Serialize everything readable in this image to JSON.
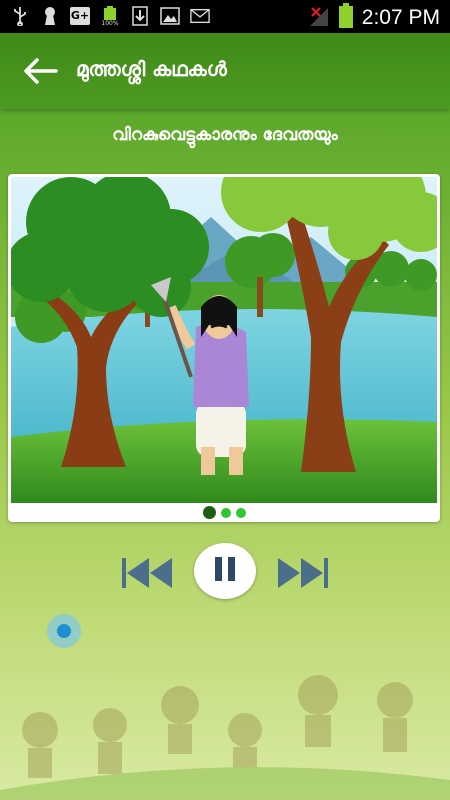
{
  "status_bar": {
    "time": "2:07 PM",
    "battery_label": "100%",
    "icons": [
      "usb-icon",
      "keyhole-icon",
      "google-plus-icon",
      "battery-full-icon",
      "download-icon",
      "image-icon",
      "email-icon",
      "no-signal-icon",
      "battery-icon"
    ],
    "gplus_text": "G+"
  },
  "app_bar": {
    "title": "മുത്തശ്ശി കഥകൾ"
  },
  "story": {
    "title": "വിറകുവെട്ടുകാരനും ദേവതയും",
    "page_count": 3,
    "current_page": 1
  },
  "player": {
    "state": "playing",
    "controls": [
      "previous-icon",
      "pause-icon",
      "next-icon"
    ]
  },
  "colors": {
    "primary": "#4d9a22",
    "dot_active": "#1d5e12",
    "dot_inactive": "#2fc62f",
    "seek_knob": "#3fa8d8"
  }
}
